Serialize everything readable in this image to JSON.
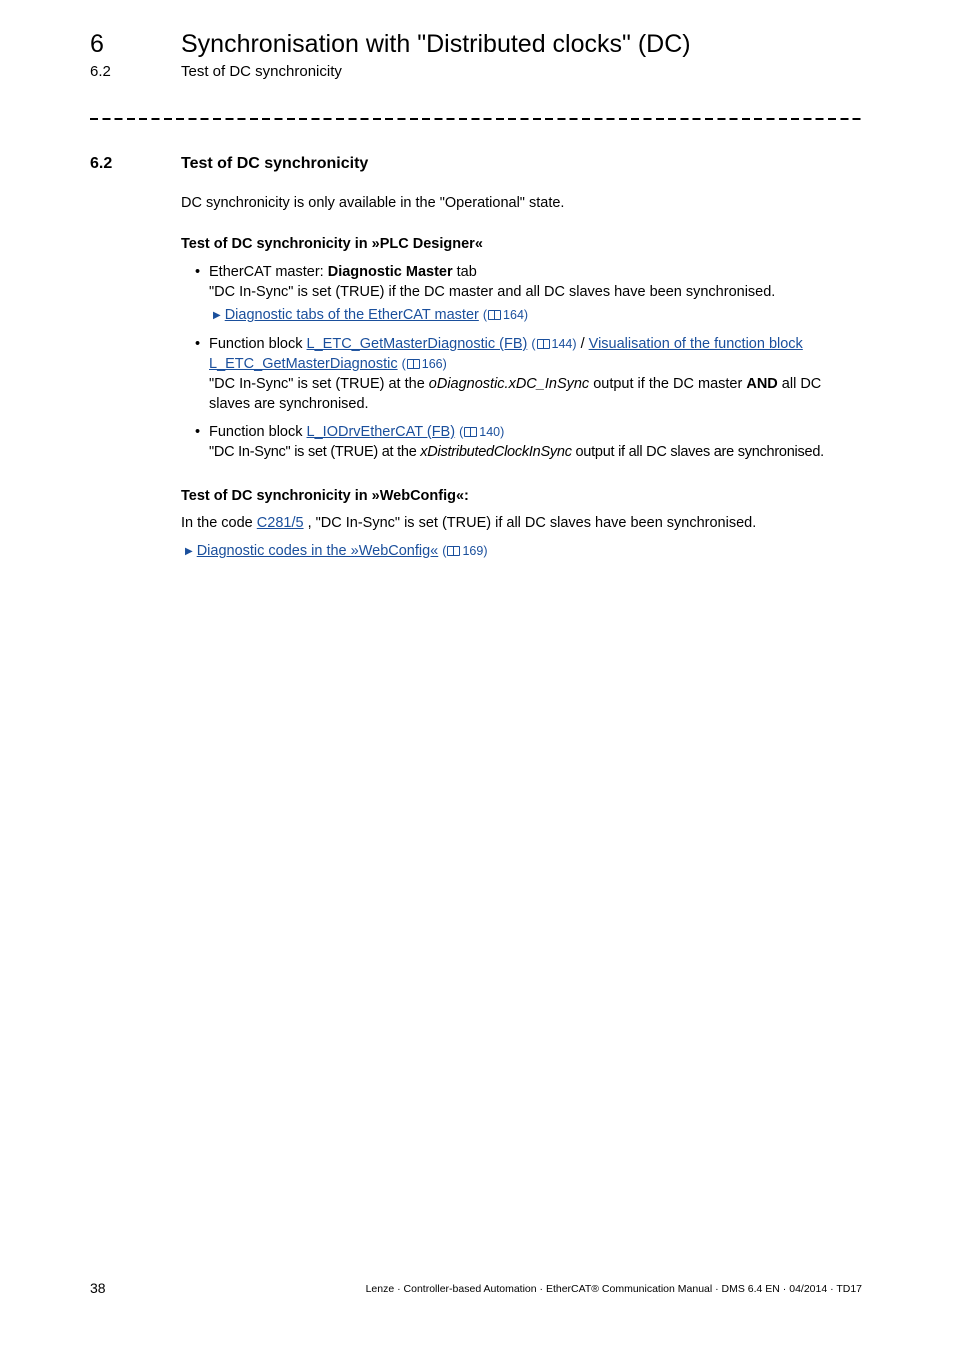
{
  "header": {
    "chapter_number": "6",
    "chapter_title": "Synchronisation with \"Distributed clocks\" (DC)",
    "section_number": "6.2",
    "section_title": "Test of DC synchronicity"
  },
  "section": {
    "number": "6.2",
    "title": "Test of DC synchronicity",
    "intro": "DC synchronicity is only available in the \"Operational\" state."
  },
  "plc": {
    "heading": "Test of DC synchronicity in »PLC Designer«",
    "items": [
      {
        "prefix": "EtherCAT master: ",
        "bold": "Diagnostic Master",
        "suffix": " tab",
        "desc": "\"DC In-Sync\" is set (TRUE) if the DC master and all DC slaves have been synchronised.",
        "link": "Diagnostic tabs of the EtherCAT master",
        "page": "164"
      },
      {
        "prefix": "Function block ",
        "link1": "L_ETC_GetMasterDiagnostic (FB)",
        "page1": "144",
        "sep": " / ",
        "link2a": "Visualisation of the function block ",
        "link2b": "L_ETC_GetMasterDiagnostic",
        "page2": "166",
        "desc_a": "\"DC In-Sync\" is set (TRUE) at the ",
        "desc_italic": "oDiagnostic.xDC_InSync",
        "desc_b": " output if the DC master ",
        "desc_bold": "AND",
        "desc_c": " all DC",
        "desc_line2": "slaves are synchronised."
      },
      {
        "prefix": "Function block ",
        "link": "L_IODrvEtherCAT (FB)",
        "page": "140",
        "desc_a": "\"DC In-Sync\" is set (TRUE) at the ",
        "desc_italic": "xDistributedClockInSync",
        "desc_b": " output if all DC slaves are synchronised."
      }
    ]
  },
  "webconfig": {
    "heading": "Test of DC synchronicity in »WebConfig«:",
    "text_a": "In the code ",
    "code_link": "C281/5",
    "text_b": " , \"DC In-Sync\" is set (TRUE) if all DC slaves have been synchronised.",
    "link": "Diagnostic codes in the »WebConfig«",
    "page": "169"
  },
  "footer": {
    "page_number": "38",
    "text": "Lenze · Controller-based Automation · EtherCAT® Communication Manual · DMS 6.4 EN · 04/2014 · TD17"
  },
  "colors": {
    "link": "#1a4f9c"
  }
}
